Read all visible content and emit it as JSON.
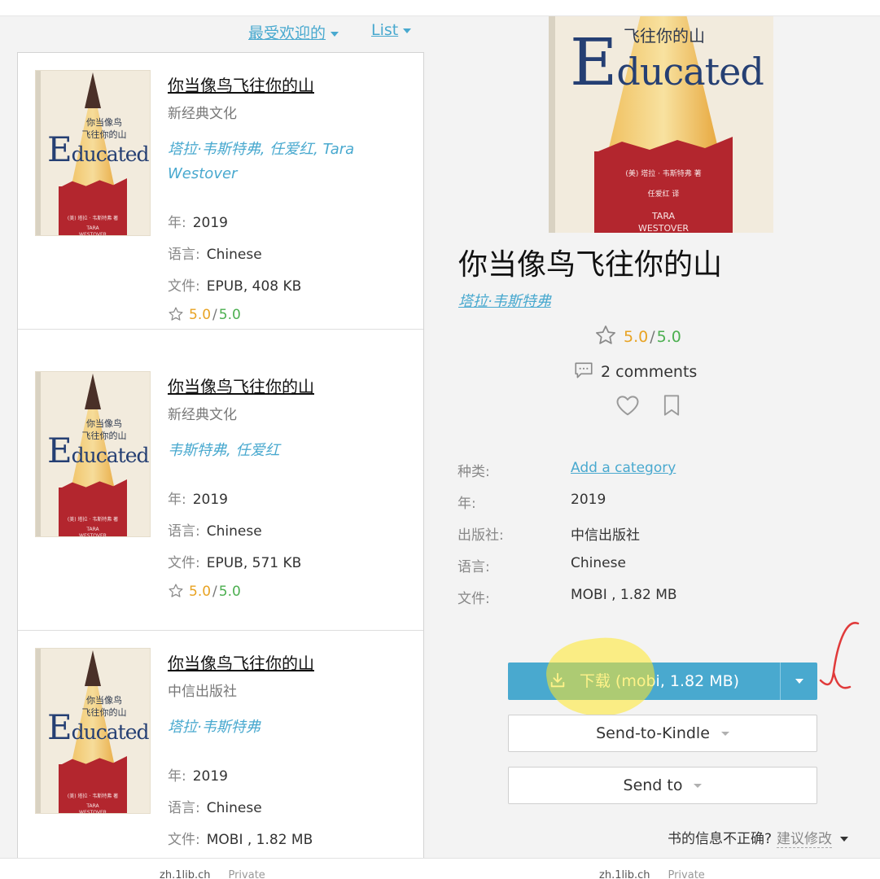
{
  "sorting": {
    "popular_label": "最受欢迎的",
    "view_label": "List"
  },
  "list": [
    {
      "title": "你当像鸟飞往你的山",
      "publisher": "新经典文化",
      "authors": "塔拉·韦斯特弗, 任爱红, Tara Westover",
      "year_label": "年:",
      "year": "2019",
      "language_label": "语言:",
      "language": "Chinese",
      "file_label": "文件:",
      "file": "EPUB, 408 KB",
      "rating": "5.0",
      "rating_max": "5.0"
    },
    {
      "title": "你当像鸟飞往你的山",
      "publisher": "新经典文化",
      "authors": "韦斯特弗, 任爱红",
      "year_label": "年:",
      "year": "2019",
      "language_label": "语言:",
      "language": "Chinese",
      "file_label": "文件:",
      "file": "EPUB, 571 KB",
      "rating": "5.0",
      "rating_max": "5.0"
    },
    {
      "title": "你当像鸟飞往你的山",
      "publisher": "中信出版社",
      "authors": "塔拉·韦斯特弗",
      "year_label": "年:",
      "year": "2019",
      "language_label": "语言:",
      "language": "Chinese",
      "file_label": "文件:",
      "file": "MOBI , 1.82 MB"
    }
  ],
  "cover": {
    "zh_line1": "你当像鸟",
    "zh_line2": "飞往你的山",
    "zh_title": "飞往你的山",
    "en_initial": "E",
    "en_rest": "ducated",
    "author_line": "(美) 塔拉 · 韦斯特弗 著",
    "translator_line": "任爱红 译",
    "author_en_1": "TARA",
    "author_en_2": "WESTOVER"
  },
  "detail": {
    "title": "你当像鸟飞往你的山",
    "author": "塔拉·韦斯特弗",
    "rating": "5.0",
    "rating_max": "5.0",
    "comments": "2 comments",
    "category_label": "种类:",
    "category_value": "Add a category",
    "year_label": "年:",
    "year": "2019",
    "publisher_label": "出版社:",
    "publisher": "中信出版社",
    "language_label": "语言:",
    "language": "Chinese",
    "file_label": "文件:",
    "file": "MOBI , 1.82 MB",
    "download_label": "下载 (mobi, 1.82 MB)",
    "send_kindle_label": "Send-to-Kindle",
    "send_to_label": "Send to",
    "incorrect_text": "书的信息不正确?",
    "suggest_label": "建议修改"
  },
  "footer": {
    "left_domain": "zh.1lib.ch",
    "left_privacy": "Private",
    "right_domain": "zh.1lib.ch",
    "right_privacy": "Private"
  },
  "colors": {
    "accent": "#49a9cf",
    "rating_value": "#e8a323",
    "rating_max": "#4caf50",
    "highlight": "#ffe828",
    "annotation": "#e03a3a"
  }
}
